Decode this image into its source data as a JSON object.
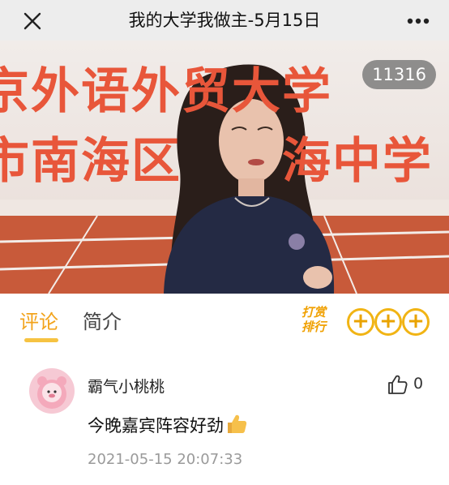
{
  "header": {
    "title": "我的大学我做主-5月15日",
    "close_icon": "close-icon",
    "more_icon": "more-dots-icon"
  },
  "video": {
    "view_count": "11316",
    "banner_line1": "京外语外贸大学",
    "banner_line2": "市南海区　　海中学",
    "banner_color": "#e8563a"
  },
  "tabs": {
    "comments": "评论",
    "intro": "简介",
    "active": "评论",
    "accent_color": "#f2a31b"
  },
  "reward": {
    "line1": "打赏",
    "line2": "排行",
    "badges": [
      "+",
      "+",
      "+"
    ]
  },
  "comment": {
    "username": "霸气小桃桃",
    "likes": "0",
    "text": "今晚嘉宾阵容好劲",
    "emoji": "thumbs-up-emoji",
    "timestamp": "2021-05-15 20:07:33"
  }
}
